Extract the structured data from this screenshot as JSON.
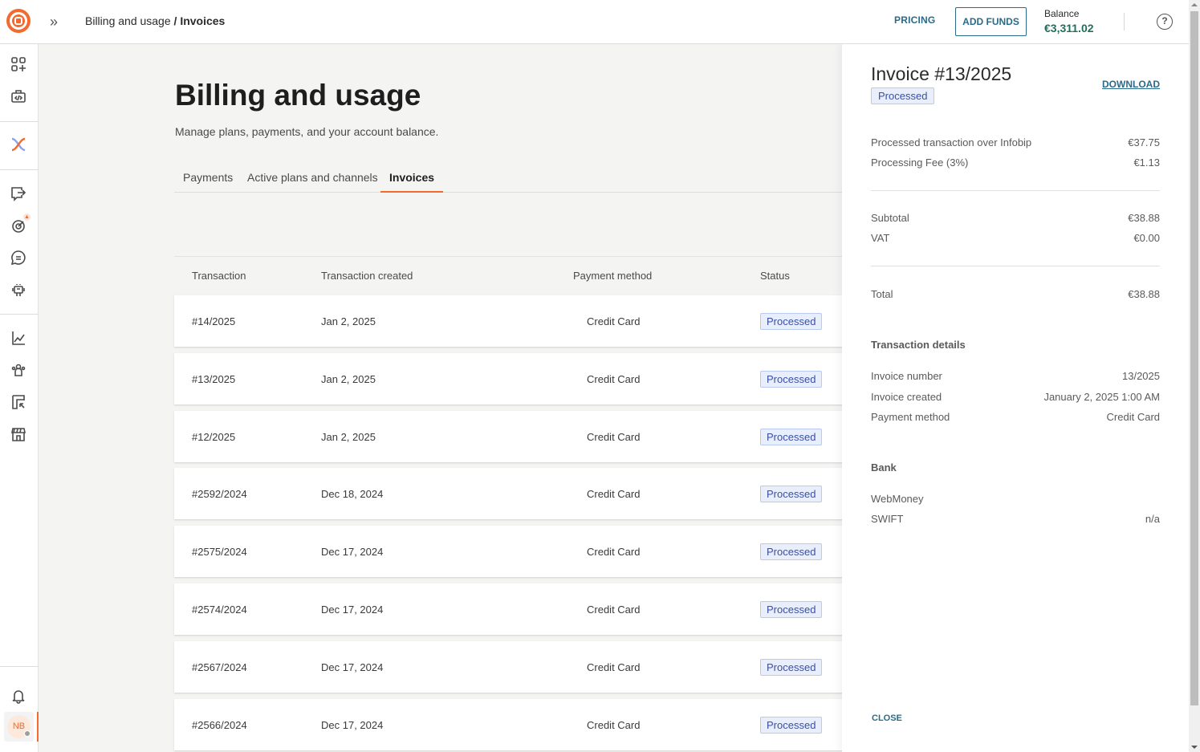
{
  "header": {
    "breadcrumb_parent": "Billing and usage",
    "breadcrumb_separator": " / ",
    "breadcrumb_current": "Invoices",
    "pricing_label": "PRICING",
    "add_funds_label": "ADD FUNDS",
    "balance_label": "Balance",
    "balance_value": "€3,311.02",
    "help_glyph": "?"
  },
  "sidebar": {
    "icons": [
      "apps-add-icon",
      "developer-tools-icon",
      "connectivity-icon",
      "export-icon",
      "campaign-target-icon",
      "chat-icon",
      "bot-icon",
      "analytics-icon",
      "people-icon",
      "exchange-icon",
      "store-icon",
      "bell-icon"
    ],
    "avatar_initials": "NB"
  },
  "page": {
    "title": "Billing and usage",
    "subtitle": "Manage plans, payments, and your account balance.",
    "tabs": [
      {
        "label": "Payments",
        "active": false
      },
      {
        "label": "Active plans and channels",
        "active": false
      },
      {
        "label": "Invoices",
        "active": true
      }
    ]
  },
  "table": {
    "columns": [
      "Transaction",
      "Transaction created",
      "Payment method",
      "Status"
    ],
    "rows": [
      {
        "transaction": "#14/2025",
        "created": "Jan 2, 2025",
        "method": "Credit Card",
        "status": "Processed"
      },
      {
        "transaction": "#13/2025",
        "created": "Jan 2, 2025",
        "method": "Credit Card",
        "status": "Processed"
      },
      {
        "transaction": "#12/2025",
        "created": "Jan 2, 2025",
        "method": "Credit Card",
        "status": "Processed"
      },
      {
        "transaction": "#2592/2024",
        "created": "Dec 18, 2024",
        "method": "Credit Card",
        "status": "Processed"
      },
      {
        "transaction": "#2575/2024",
        "created": "Dec 17, 2024",
        "method": "Credit Card",
        "status": "Processed"
      },
      {
        "transaction": "#2574/2024",
        "created": "Dec 17, 2024",
        "method": "Credit Card",
        "status": "Processed"
      },
      {
        "transaction": "#2567/2024",
        "created": "Dec 17, 2024",
        "method": "Credit Card",
        "status": "Processed"
      },
      {
        "transaction": "#2566/2024",
        "created": "Dec 17, 2024",
        "method": "Credit Card",
        "status": "Processed"
      }
    ]
  },
  "drawer": {
    "title": "Invoice #13/2025",
    "status": "Processed",
    "download_label": "DOWNLOAD",
    "line_items": [
      {
        "label": "Processed transaction over Infobip",
        "value": "€37.75"
      },
      {
        "label": "Processing Fee (3%)",
        "value": "€1.13"
      }
    ],
    "subtotal": {
      "label": "Subtotal",
      "value": "€38.88"
    },
    "vat": {
      "label": "VAT",
      "value": "€0.00"
    },
    "total": {
      "label": "Total",
      "value": "€38.88"
    },
    "details_heading": "Transaction details",
    "details": [
      {
        "label": "Invoice number",
        "value": "13/2025"
      },
      {
        "label": "Invoice created",
        "value": "January 2, 2025 1:00 AM"
      },
      {
        "label": "Payment method",
        "value": "Credit Card"
      }
    ],
    "bank_heading": "Bank",
    "bank": [
      {
        "label": "WebMoney",
        "value": ""
      },
      {
        "label": "SWIFT",
        "value": "n/a"
      }
    ],
    "close_label": "CLOSE"
  },
  "colors": {
    "brand": "#f26a2e",
    "link": "#2a6a8a",
    "balance": "#1f6f5c",
    "status_text": "#3a4fa6",
    "status_bg": "#e8eefc"
  }
}
